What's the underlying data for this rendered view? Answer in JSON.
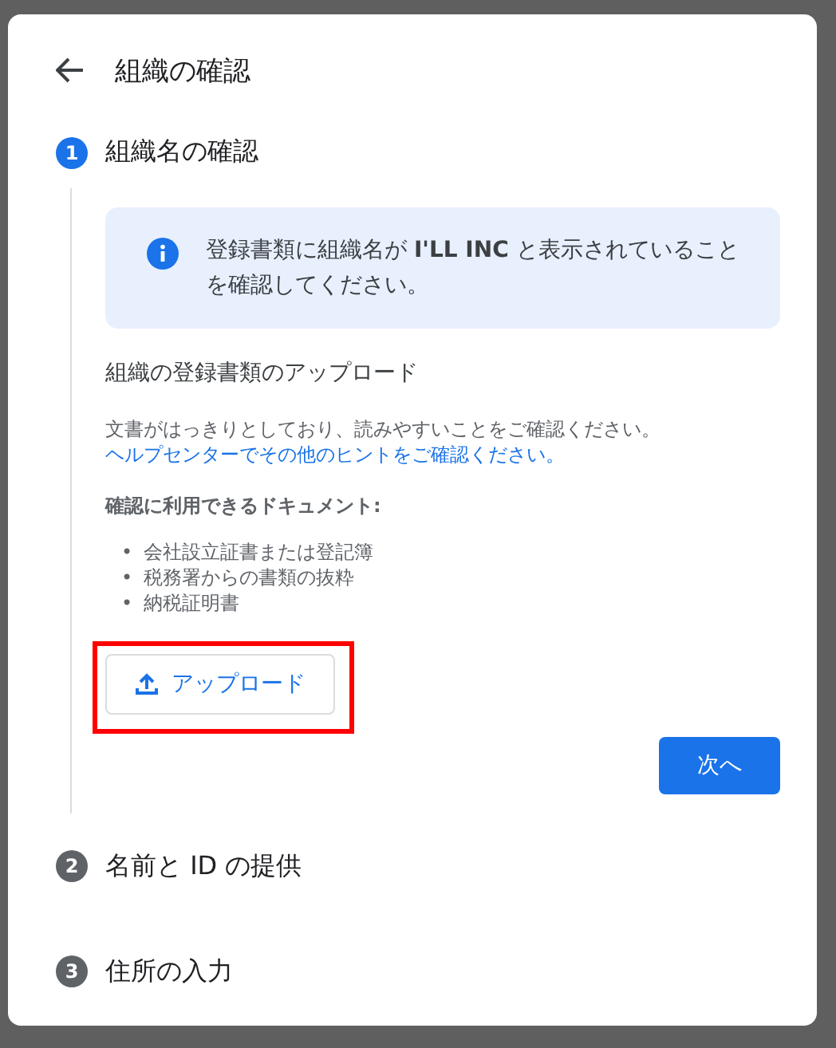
{
  "dialog": {
    "title": "組織の確認"
  },
  "steps": [
    {
      "number": "1",
      "label": "組織名の確認",
      "active": true
    },
    {
      "number": "2",
      "label": "名前と ID の提供",
      "active": false
    },
    {
      "number": "3",
      "label": "住所の入力",
      "active": false
    }
  ],
  "info": {
    "text": "登録書類に組織名が **I'LL INC** と表示されていることを確認してください。"
  },
  "upload_section": {
    "heading": "組織の登録書類のアップロード",
    "description": "文書がはっきりとしており、読みやすいことをご確認ください。",
    "help_link": "ヘルプセンターでその他のヒントをご確認ください。",
    "documents_heading": "確認に利用できるドキュメント:",
    "documents": [
      {
        "bullet": "•",
        "text": "会社設立証書または登記簿"
      },
      {
        "bullet": "•",
        "text": "税務署からの書類の抜粋"
      },
      {
        "bullet": "•",
        "text": "納税証明書"
      }
    ],
    "upload_button": "アップロード",
    "highlighted": true
  },
  "next_button": "次へ"
}
